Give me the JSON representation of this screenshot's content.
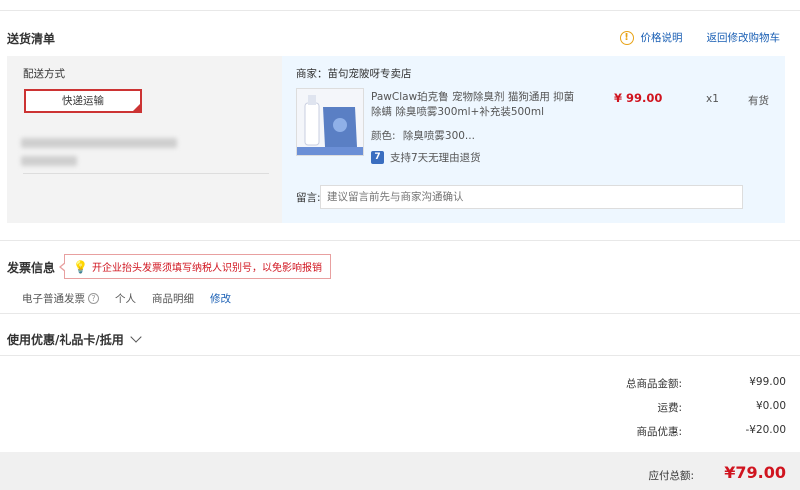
{
  "delivery": {
    "section_title": "送货清单",
    "price_note_link": "价格说明",
    "return_cart_link": "返回修改购物车",
    "shipping_label": "配送方式",
    "shipping_option": "快递运输"
  },
  "store": {
    "name": "商家：苗句宠陂呀专卖店",
    "product_title": "PawClaw珀克鲁 宠物除臭剂 猫狗通用 抑菌除螨 除臭喷雾300ml+补充装500ml",
    "price": "¥ 99.00",
    "qty": "x1",
    "stock": "有货",
    "color_label": "颜色:",
    "color_value": "除臭喷雾300...",
    "return_badge": "7",
    "return_policy": "支持7天无理由退货",
    "note_label": "留言:",
    "note_placeholder": "建议留言前先与商家沟通确认"
  },
  "invoice": {
    "section_title": "发票信息",
    "tip": "开企业抬头发票须填写纳税人识别号，以免影响报销",
    "type": "电子普通发票",
    "title": "个人",
    "content": "商品明细",
    "edit_link": "修改"
  },
  "coupon": {
    "title": "使用优惠/礼品卡/抵用"
  },
  "summary": {
    "rows": [
      {
        "label": "总商品金额:",
        "value": "¥99.00"
      },
      {
        "label": "运费:",
        "value": "¥0.00"
      },
      {
        "label": "商品优惠:",
        "value": "-¥20.00"
      }
    ],
    "total_label": "应付总额:",
    "total_value": "¥79.00"
  },
  "colors": {
    "accent_red": "#d0141f",
    "link_blue": "#1a5fb4",
    "store_panel_bg": "#eef7ff",
    "ship_panel_bg": "#f3f3f3"
  },
  "icons": [
    "info-icon",
    "return-policy-icon",
    "lightbulb-icon",
    "question-icon",
    "chevron-down-icon"
  ]
}
